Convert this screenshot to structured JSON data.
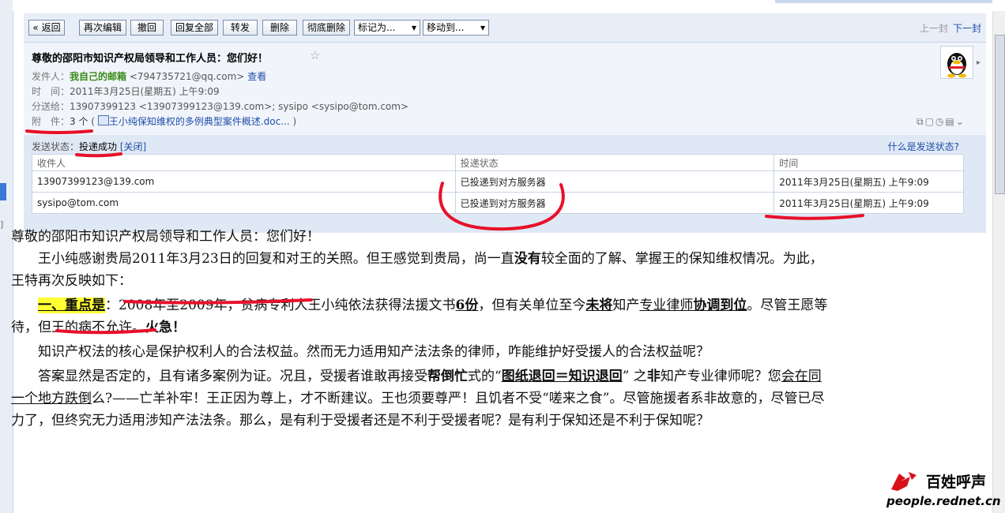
{
  "toolbar": {
    "back": "« 返回",
    "reedit": "再次编辑",
    "recall": "撤回",
    "reply_all": "回复全部",
    "forward": "转发",
    "delete": "删除",
    "purge": "彻底删除",
    "mark_as": "标记为...",
    "move_to": "移动到...",
    "prev": "上一封",
    "next": "下一封"
  },
  "email": {
    "subject": "尊敬的邵阳市知识产权局领导和工作人员：您们好！",
    "from_label": "发件人：",
    "from_name": "我自己的邮箱",
    "from_addr": "<794735721@qq.com>",
    "view": "查看",
    "time_label": "时　间：",
    "time": "2011年3月25日(星期五) 上午9:09",
    "to_label": "分送给：",
    "to": "13907399123 <13907399123@139.com>; sysipo <sysipo@tom.com>",
    "attach_label": "附　件：",
    "attach_count": "3 个",
    "attach_open": "(",
    "attach_name": "王小纯保知维权的多例典型案件概述.doc...",
    "attach_close": ")"
  },
  "send_status": {
    "label": "发送状态：",
    "value": "投递成功",
    "close": "[关闭]",
    "help": "什么是发送状态?",
    "headers": [
      "收件人",
      "投递状态",
      "时间"
    ],
    "rows": [
      [
        "13907399123@139.com",
        "已投递到对方服务器",
        "2011年3月25日(星期五) 上午9:09"
      ],
      [
        "sysipo@tom.com",
        "已投递到对方服务器",
        "2011年3月25日(星期五) 上午9:09"
      ]
    ]
  },
  "body": {
    "greeting": "尊敬的邵阳市知识产权局领导和工作人员：您们好！",
    "p1a": "王小纯感谢贵局2011年3月23日的回复和对王的关照。但王感觉到贵局，尚一直",
    "p1b": "没有",
    "p1c": "较全面的了解、掌握王的保知维权情况。",
    "p1d": "为此，王特再次反映如下：",
    "p2a": "一、重点是",
    "p2b": "：2008年至2009年，贫病专利人王小纯依法获得法援文书",
    "p2c": "6份",
    "p2d": "，但有关单位至今",
    "p2e": "未将",
    "p2f": "知产",
    "p2g": "专业律师",
    "p2h": "协调到位",
    "p2i": "。尽管王愿等待，但王的病不允许。",
    "p2j": "火急！",
    "p3": "知识产权法的核心是保护权利人的合法权益。然而无力适用知产法法条的律师，咋能维护好受援人的合法权益呢？",
    "p4a": "答案显然是否定的，且有诸多案例为证。况且，受援者谁敢再接受",
    "p4b": "帮倒忙",
    "p4c": "式的“",
    "p4d": "图纸退回＝知识退回",
    "p4e": "” 之",
    "p4f": "非",
    "p4g": "知产专业律师呢？您",
    "p4h": "会在同一个地方跌倒",
    "p4i": "么?——亡羊补牢！王正因为尊上，才不断建议。王也须要尊严！且饥者不受“嗟来之食”。尽管施援者系非故意的，尽管已尽力了，但终究无力适用涉知产法法条。那么，是有利于受援者还是不利于受援者呢？是有利于保知还是不利于保知呢？"
  },
  "watermark": {
    "brand": "百姓呼声",
    "site": "people.rednet.cn"
  },
  "colors": {
    "toolbar_bg": "#e8eef8",
    "header_bg": "#f1f5fb",
    "status_bg": "#dfe8f5",
    "link": "#1f4ea8",
    "sender_green": "#3a8a1a",
    "annotation_red": "#e8102a",
    "highlight": "#ffff33"
  }
}
